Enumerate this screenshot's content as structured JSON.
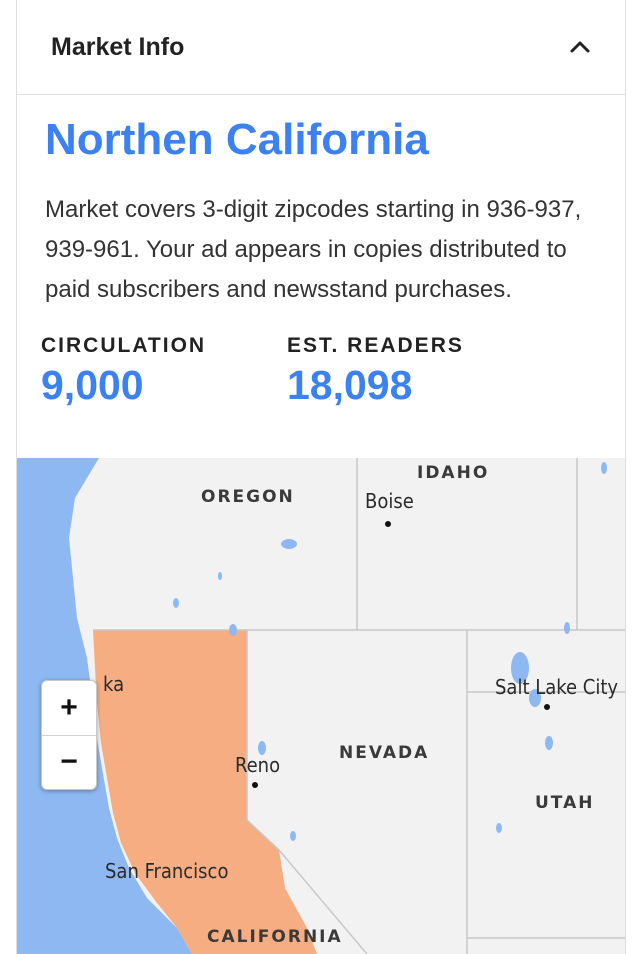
{
  "header": {
    "title": "Market Info",
    "chevron_icon": "chevron-up-icon"
  },
  "market": {
    "name": "Northen California",
    "description": "Market covers 3-digit zipcodes starting in 936-937, 939-961. Your ad appears in copies distributed to paid subscribers and newsstand purchases."
  },
  "stats": {
    "circulation": {
      "label": "CIRCULATION",
      "value": "9,000"
    },
    "readers": {
      "label": "EST. READERS",
      "value": "18,098"
    }
  },
  "map": {
    "zoom_in": "+",
    "zoom_out": "−",
    "labels": {
      "idaho": "IDAHO",
      "oregon": "OREGON",
      "nevada": "NEVADA",
      "utah": "UTAH",
      "california": "CALIFORNIA",
      "boise": "Boise",
      "salt_lake_city": "Salt Lake City",
      "reno": "Reno",
      "san_francisco": "San Francisco",
      "eureka_fragment": "ka"
    },
    "colors": {
      "ocean": "#8db8f2",
      "land": "#f2f2f2",
      "highlight": "#f6ad81",
      "borders": "#c8c8c8"
    }
  }
}
